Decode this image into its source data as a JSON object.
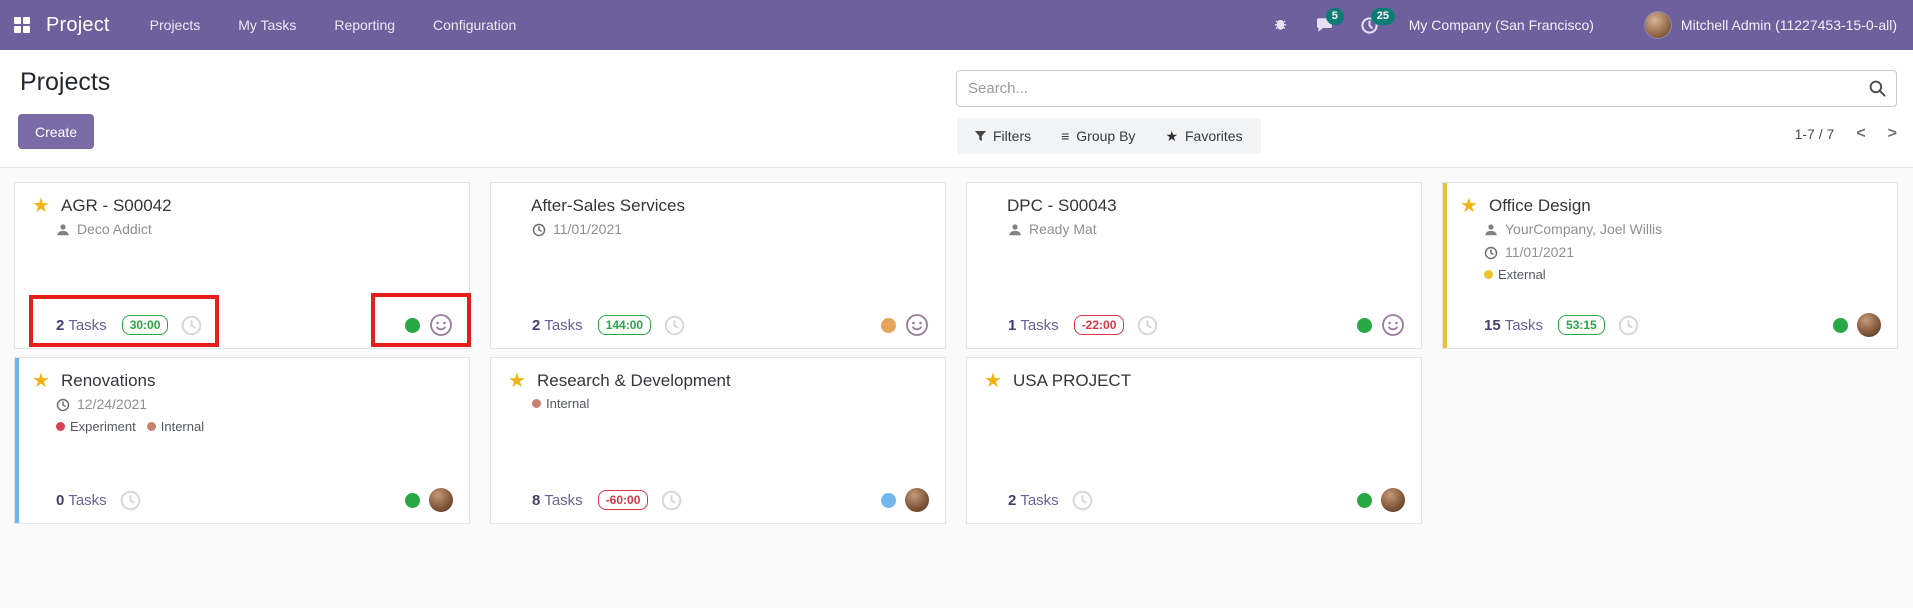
{
  "navbar": {
    "app_name": "Project",
    "menus": [
      {
        "label": "Projects"
      },
      {
        "label": "My Tasks"
      },
      {
        "label": "Reporting"
      },
      {
        "label": "Configuration"
      }
    ],
    "messages_count": "5",
    "activities_count": "25",
    "company": "My Company (San Francisco)",
    "user": "Mitchell Admin (11227453-15-0-all)"
  },
  "control_panel": {
    "title": "Projects",
    "create_label": "Create",
    "search_placeholder": "Search...",
    "filters_label": "Filters",
    "group_by_label": "Group By",
    "favorites_label": "Favorites",
    "pager_range": "1-7 / 7"
  },
  "labels": {
    "tasks": "Tasks"
  },
  "icons": {
    "apps": "grid-squares",
    "bug": "bug",
    "messages": "speech-bubble",
    "activities": "clock",
    "search": "magnifier",
    "filters": "funnel",
    "group_by_glyph": "≡",
    "favorites_glyph": "★",
    "favorite_star_glyph": "★",
    "partner": "person-silhouette",
    "deadline": "clock",
    "remaining_hours": "clock-outline",
    "collaborator": "smiley-face",
    "pager_previous_glyph": "<",
    "pager_next_glyph": ">"
  },
  "colors": {
    "navbar": "#6d609c",
    "primary_button": "#7a6aa5",
    "systray_badge": "#0e7c74",
    "positive_hours": "#28a745",
    "negative_hours": "#dc3545",
    "favorite_star": "#efb513",
    "accent_office_design": "#eec22c",
    "accent_renovations": "#6cb5ee",
    "dot_green": "#27a844",
    "dot_orange": "#e5a55b",
    "dot_blue": "#72b8ef",
    "annotation_highlight": "#e31f1a"
  },
  "cards": [
    {
      "title": "AGR - S00042",
      "starred": true,
      "partner": "Deco Addict",
      "tasks_count": "2",
      "hours": "30:00",
      "hours_state": "positive",
      "status_dot": "green",
      "member": "smiley",
      "annotated": true
    },
    {
      "title": "After-Sales Services",
      "starred": false,
      "deadline": "11/01/2021",
      "tasks_count": "2",
      "hours": "144:00",
      "hours_state": "positive",
      "status_dot": "orange",
      "member": "smiley"
    },
    {
      "title": "DPC - S00043",
      "starred": false,
      "partner": "Ready Mat",
      "tasks_count": "1",
      "hours": "-22:00",
      "hours_state": "negative",
      "status_dot": "green",
      "member": "smiley"
    },
    {
      "title": "Office Design",
      "starred": true,
      "accent": "#eec22c",
      "partner": "YourCompany, Joel Willis",
      "deadline": "11/01/2021",
      "tags": [
        {
          "label": "External",
          "color": "#efc32c"
        }
      ],
      "tasks_count": "15",
      "hours": "53:15",
      "hours_state": "positive",
      "status_dot": "green",
      "member": "avatar"
    },
    {
      "title": "Renovations",
      "starred": true,
      "accent": "#6cb5ee",
      "deadline": "12/24/2021",
      "tags": [
        {
          "label": "Experiment",
          "color": "#da4254"
        },
        {
          "label": "Internal",
          "color": "#c9826f"
        }
      ],
      "tasks_count": "0",
      "hours": null,
      "status_dot": "green",
      "member": "avatar"
    },
    {
      "title": "Research & Development",
      "starred": true,
      "tags": [
        {
          "label": "Internal",
          "color": "#c9826f"
        }
      ],
      "tasks_count": "8",
      "hours": "-60:00",
      "hours_state": "negative",
      "status_dot": "blue",
      "member": "avatar"
    },
    {
      "title": "USA PROJECT",
      "starred": true,
      "tasks_count": "2",
      "hours": null,
      "status_dot": "green",
      "member": "avatar"
    }
  ],
  "annotations": {
    "color": "#e31f1a",
    "regions": [
      "card-1-tasks-and-hours",
      "card-1-status-dot-and-collaborator"
    ]
  }
}
